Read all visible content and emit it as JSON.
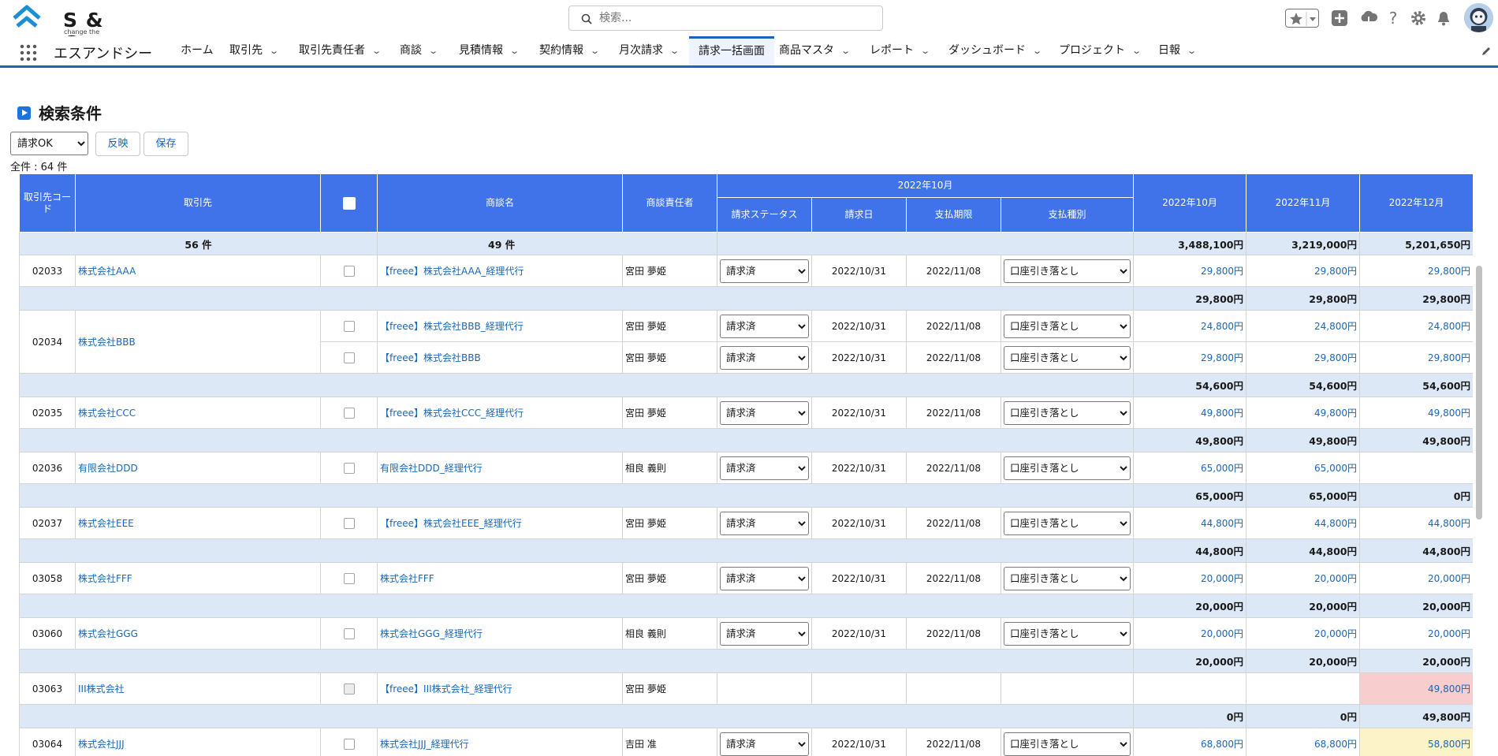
{
  "header": {
    "logo_text": "S & C",
    "logo_tagline": "change the system",
    "search_placeholder": "検索..."
  },
  "nav": {
    "app_name": "エスアンドシー",
    "items": [
      {
        "label": "ホーム",
        "dropdown": false
      },
      {
        "label": "取引先",
        "dropdown": true
      },
      {
        "label": "取引先責任者",
        "dropdown": true
      },
      {
        "label": "商談",
        "dropdown": true
      },
      {
        "label": "見積情報",
        "dropdown": true
      },
      {
        "label": "契約情報",
        "dropdown": true
      },
      {
        "label": "月次請求",
        "dropdown": true
      },
      {
        "label": "請求一括画面",
        "dropdown": false,
        "active": true
      },
      {
        "label": "商品マスタ",
        "dropdown": true
      },
      {
        "label": "レポート",
        "dropdown": true
      },
      {
        "label": "ダッシュボード",
        "dropdown": true
      },
      {
        "label": "プロジェクト",
        "dropdown": true
      },
      {
        "label": "日報",
        "dropdown": true
      }
    ]
  },
  "filter": {
    "title": "検索条件",
    "select_value": "請求OK",
    "reflect_label": "反映",
    "save_label": "保存",
    "count_text": "全件 : 64 件"
  },
  "table": {
    "headers": {
      "code": "取引先コード",
      "account": "取引先",
      "deal": "商談名",
      "owner": "商談責任者",
      "month_group": "2022年10月",
      "status": "請求ステータス",
      "bill_date": "請求日",
      "due_date": "支払期限",
      "pay_type": "支払種別",
      "m1": "2022年10月",
      "m2": "2022年11月",
      "m3": "2022年12月"
    },
    "totals": {
      "account_count": "56 件",
      "deal_count": "49 件",
      "m1": "3,488,100円",
      "m2": "3,219,000円",
      "m3": "5,201,650円"
    },
    "groups": [
      {
        "code": "02033",
        "account": "株式会社AAA",
        "rows": [
          {
            "deal": "【freee】株式会社AAA_経理代行",
            "owner": "宮田 夢姫",
            "status": "請求済",
            "bill": "2022/10/31",
            "due": "2022/11/08",
            "pay": "口座引き落とし",
            "m1": "29,800円",
            "m2": "29,800円",
            "m3": "29,800円"
          }
        ],
        "sum": {
          "m1": "29,800円",
          "m2": "29,800円",
          "m3": "29,800円"
        }
      },
      {
        "code": "02034",
        "account": "株式会社BBB",
        "rows": [
          {
            "deal": "【freee】株式会社BBB_経理代行",
            "owner": "宮田 夢姫",
            "status": "請求済",
            "bill": "2022/10/31",
            "due": "2022/11/08",
            "pay": "口座引き落とし",
            "m1": "24,800円",
            "m2": "24,800円",
            "m3": "24,800円"
          },
          {
            "deal": "【freee】株式会社BBB",
            "owner": "宮田 夢姫",
            "status": "請求済",
            "bill": "2022/10/31",
            "due": "2022/11/08",
            "pay": "口座引き落とし",
            "m1": "29,800円",
            "m2": "29,800円",
            "m3": "29,800円"
          }
        ],
        "sum": {
          "m1": "54,600円",
          "m2": "54,600円",
          "m3": "54,600円"
        }
      },
      {
        "code": "02035",
        "account": "株式会社CCC",
        "rows": [
          {
            "deal": "【freee】株式会社CCC_経理代行",
            "owner": "宮田 夢姫",
            "status": "請求済",
            "bill": "2022/10/31",
            "due": "2022/11/08",
            "pay": "口座引き落とし",
            "m1": "49,800円",
            "m2": "49,800円",
            "m3": "49,800円"
          }
        ],
        "sum": {
          "m1": "49,800円",
          "m2": "49,800円",
          "m3": "49,800円"
        }
      },
      {
        "code": "02036",
        "account": "有限会社DDD",
        "rows": [
          {
            "deal": "有限会社DDD_経理代行",
            "owner": "相良 義則",
            "status": "請求済",
            "bill": "2022/10/31",
            "due": "2022/11/08",
            "pay": "口座引き落とし",
            "m1": "65,000円",
            "m2": "65,000円",
            "m3": ""
          }
        ],
        "sum": {
          "m1": "65,000円",
          "m2": "65,000円",
          "m3": "0円"
        }
      },
      {
        "code": "02037",
        "account": "株式会社EEE",
        "rows": [
          {
            "deal": "【freee】株式会社EEE_経理代行",
            "owner": "宮田 夢姫",
            "status": "請求済",
            "bill": "2022/10/31",
            "due": "2022/11/08",
            "pay": "口座引き落とし",
            "m1": "44,800円",
            "m2": "44,800円",
            "m3": "44,800円"
          }
        ],
        "sum": {
          "m1": "44,800円",
          "m2": "44,800円",
          "m3": "44,800円"
        }
      },
      {
        "code": "03058",
        "account": "株式会社FFF",
        "rows": [
          {
            "deal": "株式会社FFF",
            "owner": "宮田 夢姫",
            "status": "請求済",
            "bill": "2022/10/31",
            "due": "2022/11/08",
            "pay": "口座引き落とし",
            "m1": "20,000円",
            "m2": "20,000円",
            "m3": "20,000円"
          }
        ],
        "sum": {
          "m1": "20,000円",
          "m2": "20,000円",
          "m3": "20,000円"
        }
      },
      {
        "code": "03060",
        "account": "株式会社GGG",
        "rows": [
          {
            "deal": "株式会社GGG_経理代行",
            "owner": "相良 義則",
            "status": "請求済",
            "bill": "2022/10/31",
            "due": "2022/11/08",
            "pay": "口座引き落とし",
            "m1": "20,000円",
            "m2": "20,000円",
            "m3": "20,000円"
          }
        ],
        "sum": {
          "m1": "20,000円",
          "m2": "20,000円",
          "m3": "20,000円"
        }
      },
      {
        "code": "03063",
        "account": "III株式会社",
        "rows": [
          {
            "deal": "【freee】III株式会社_経理代行",
            "owner": "宮田 夢姫",
            "status": "",
            "bill": "",
            "due": "",
            "pay": "",
            "m1": "",
            "m2": "",
            "m3": "49,800円",
            "m3_highlight": "pink",
            "disabled": true
          }
        ],
        "sum": {
          "m1": "0円",
          "m2": "0円",
          "m3": "49,800円"
        }
      },
      {
        "code": "03064",
        "account": "株式会社JJJ",
        "rows": [
          {
            "deal": "株式会社JJJ_経理代行",
            "owner": "吉田 准",
            "status": "請求済",
            "bill": "2022/10/31",
            "due": "2022/11/08",
            "pay": "口座引き落とし",
            "m1": "68,800円",
            "m2": "68,800円",
            "m3": "58,800円",
            "m3_highlight": "yellow"
          }
        ]
      }
    ]
  },
  "colors": {
    "header_blue": "#4072ea",
    "summary_row": "#dce8f6",
    "link": "#1a67b8",
    "pink_cell": "#f7cdcd",
    "yellow_cell": "#fdf3c9",
    "nav_accent": "#1b62c1"
  }
}
